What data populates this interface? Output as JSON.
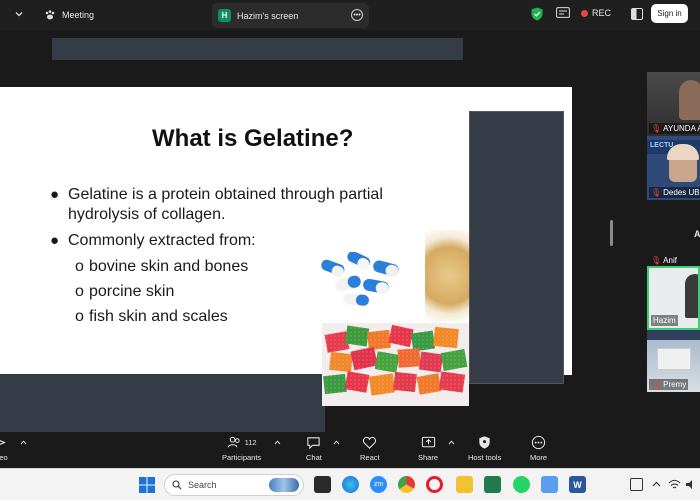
{
  "topbar": {
    "meeting_label": "Meeting",
    "screen_tab_badge": "H",
    "screen_tab_label": "Hazim's screen",
    "rec_label": "REC",
    "signin_label": "Sign in"
  },
  "slide": {
    "title": "What is Gelatine?",
    "bullet1": "Gelatine is a protein obtained through partial hydrolysis of collagen.",
    "bullet2": "Commonly extracted from:",
    "sub_items": [
      "bovine skin and bones",
      "porcine skin",
      "fish skin and scales"
    ],
    "sub_marker": "o"
  },
  "participants_panel": {
    "tiles": [
      {
        "name": "AYUNDA A"
      },
      {
        "name": "Dedes UB"
      },
      {
        "name": "Anif"
      },
      {
        "name": "Hazim"
      },
      {
        "name": "Premy"
      }
    ],
    "side_letter": "A",
    "banner_text": "LECTU"
  },
  "toolbar": {
    "video_label": "eo",
    "participants_label": "Participants",
    "participants_count": "112",
    "chat_label": "Chat",
    "react_label": "React",
    "share_label": "Share",
    "host_tools_label": "Host tools",
    "more_label": "More"
  },
  "taskbar": {
    "search_placeholder": "Search"
  },
  "colors": {
    "accent_green": "#0e8f64",
    "rec_red": "#e5483e",
    "slide_dark": "#363c47",
    "active_speaker": "#3ccf73"
  }
}
